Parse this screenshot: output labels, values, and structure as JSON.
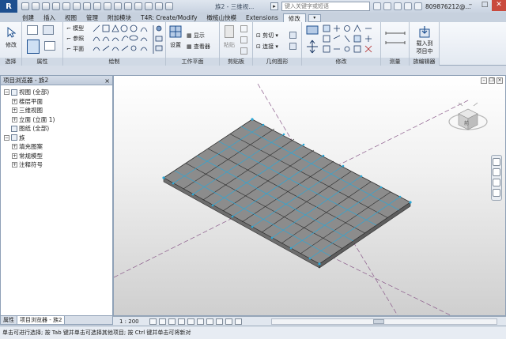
{
  "title_bar": {
    "logo": "R",
    "doc_title": "族2 - 三维视...",
    "search_placeholder": "键入关键字或短语",
    "user": "809876212@...",
    "win_min": "–",
    "win_max": "□",
    "win_close": "✕"
  },
  "tabs": [
    "创建",
    "插入",
    "视图",
    "管理",
    "附加模块",
    "T4R: Create/Modify",
    "橄榄山快模",
    "Extensions",
    "修改"
  ],
  "active_tab": "修改",
  "ribbon": {
    "modify_btn": "修改",
    "model_line": "模型",
    "ref": "参照",
    "plane": "平面",
    "settings": "设置",
    "show": "显示",
    "viewer": "查看器",
    "paste": "粘贴",
    "cut": "剪切",
    "join": "连接",
    "load_line1": "载入到",
    "load_line2": "项目中",
    "panels": {
      "select": "选择",
      "properties": "属性",
      "draw": "绘制",
      "workplane": "工作平面",
      "clipboard": "剪贴板",
      "geometry": "几何图形",
      "modify": "修改",
      "measure": "测量",
      "family_editor": "族编辑器"
    }
  },
  "browser": {
    "title": "项目浏览器 - 族2",
    "close": "×",
    "tree": [
      {
        "toggle": "−",
        "label": "视图 (全部)",
        "indent": 0
      },
      {
        "toggle": "+",
        "label": "楼层平面",
        "indent": 1
      },
      {
        "toggle": "+",
        "label": "三维视图",
        "indent": 1
      },
      {
        "toggle": "+",
        "label": "立面 (立面 1)",
        "indent": 1
      },
      {
        "toggle": "",
        "label": "图纸 (全部)",
        "indent": 0
      },
      {
        "toggle": "−",
        "label": "族",
        "indent": 0
      },
      {
        "toggle": "+",
        "label": "填充图案",
        "indent": 1
      },
      {
        "toggle": "+",
        "label": "常规模型",
        "indent": 1
      },
      {
        "toggle": "+",
        "label": "注释符号",
        "indent": 1
      }
    ],
    "tabs": [
      "属性",
      "项目浏览器 - 族2"
    ]
  },
  "viewcube": {
    "label": "前"
  },
  "view_control": {
    "scale": "1 : 200"
  },
  "status_bar": {
    "text": "单击可进行选择; 按 Tab 键并单击可选择其他项目; 按 Ctrl 键并单击可将新对"
  }
}
